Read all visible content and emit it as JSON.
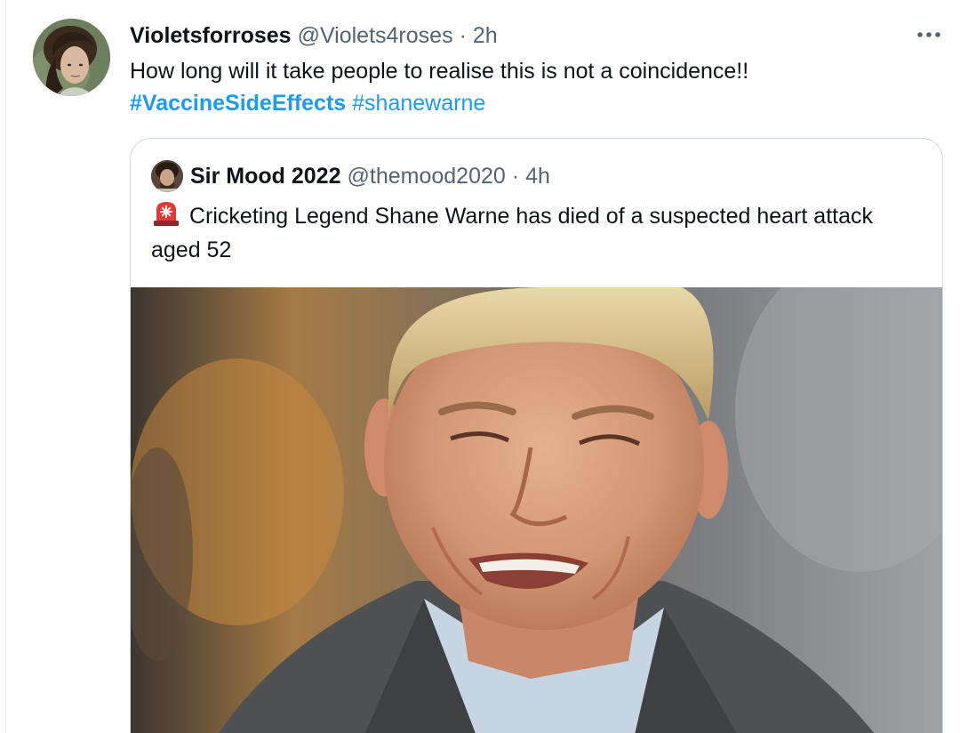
{
  "tweet": {
    "display_name": "Violetsforroses",
    "handle": "@Violets4roses",
    "separator": "·",
    "time": "2h",
    "text_main": "How long will it take people to realise this is not a coincidence!!",
    "hashtags": [
      "#VaccineSideEffects",
      "#shanewarne"
    ],
    "more_icon": "more-horizontal-icon"
  },
  "quoted_tweet": {
    "display_name": "Sir Mood 2022",
    "handle": "@themood2020",
    "separator": "·",
    "time": "4h",
    "emoji_icon": "police-siren-icon",
    "text": "Cricketing Legend Shane Warne has died of a suspected heart attack aged 52",
    "media": "photo"
  },
  "colors": {
    "link": "#1d9bf0",
    "text": "#0f1419",
    "secondary": "#536471",
    "border": "#cfd9de"
  }
}
